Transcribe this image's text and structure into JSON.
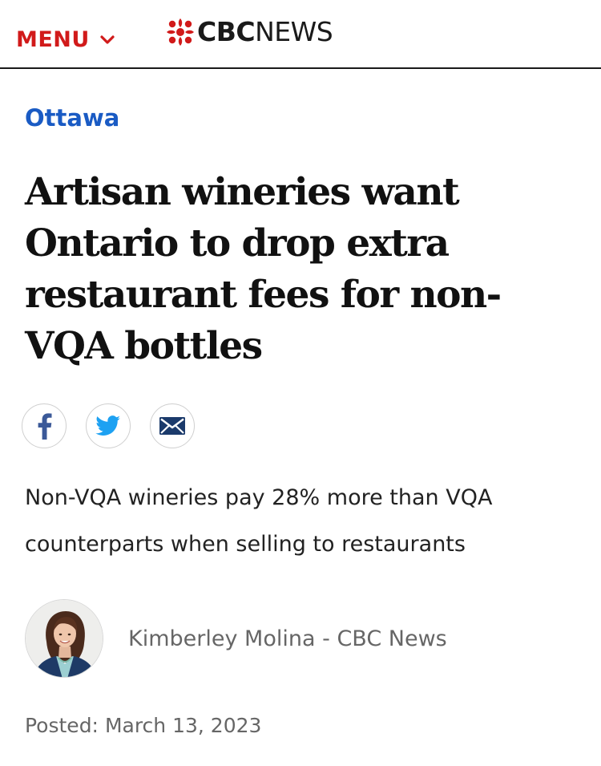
{
  "header": {
    "menu_label": "MENU",
    "brand_cbc": "CBC",
    "brand_news": "NEWS"
  },
  "article": {
    "section": "Ottawa",
    "headline_lines": [
      "Artisan wineries want",
      "Ontario to drop extra",
      "restaurant fees for non-",
      "VQA bottles"
    ],
    "share": [
      {
        "name": "facebook",
        "icon": "facebook-icon"
      },
      {
        "name": "twitter",
        "icon": "twitter-icon"
      },
      {
        "name": "email",
        "icon": "email-icon"
      }
    ],
    "deck_lines": [
      "Non-VQA wineries pay 28% more than VQA",
      "counterparts when selling to restaurants"
    ],
    "author": {
      "name": "Kimberley Molina",
      "separator": " - ",
      "outlet": "CBC News"
    },
    "posted_label": "Posted:",
    "posted_date": "March 13, 2023"
  },
  "colors": {
    "brand_red": "#d11a1a",
    "section_blue": "#1a5bc4",
    "twitter_blue": "#1da1f2",
    "facebook_blue": "#3b5998",
    "email_navy": "#1b3a6b",
    "meta_gray": "#666666"
  }
}
